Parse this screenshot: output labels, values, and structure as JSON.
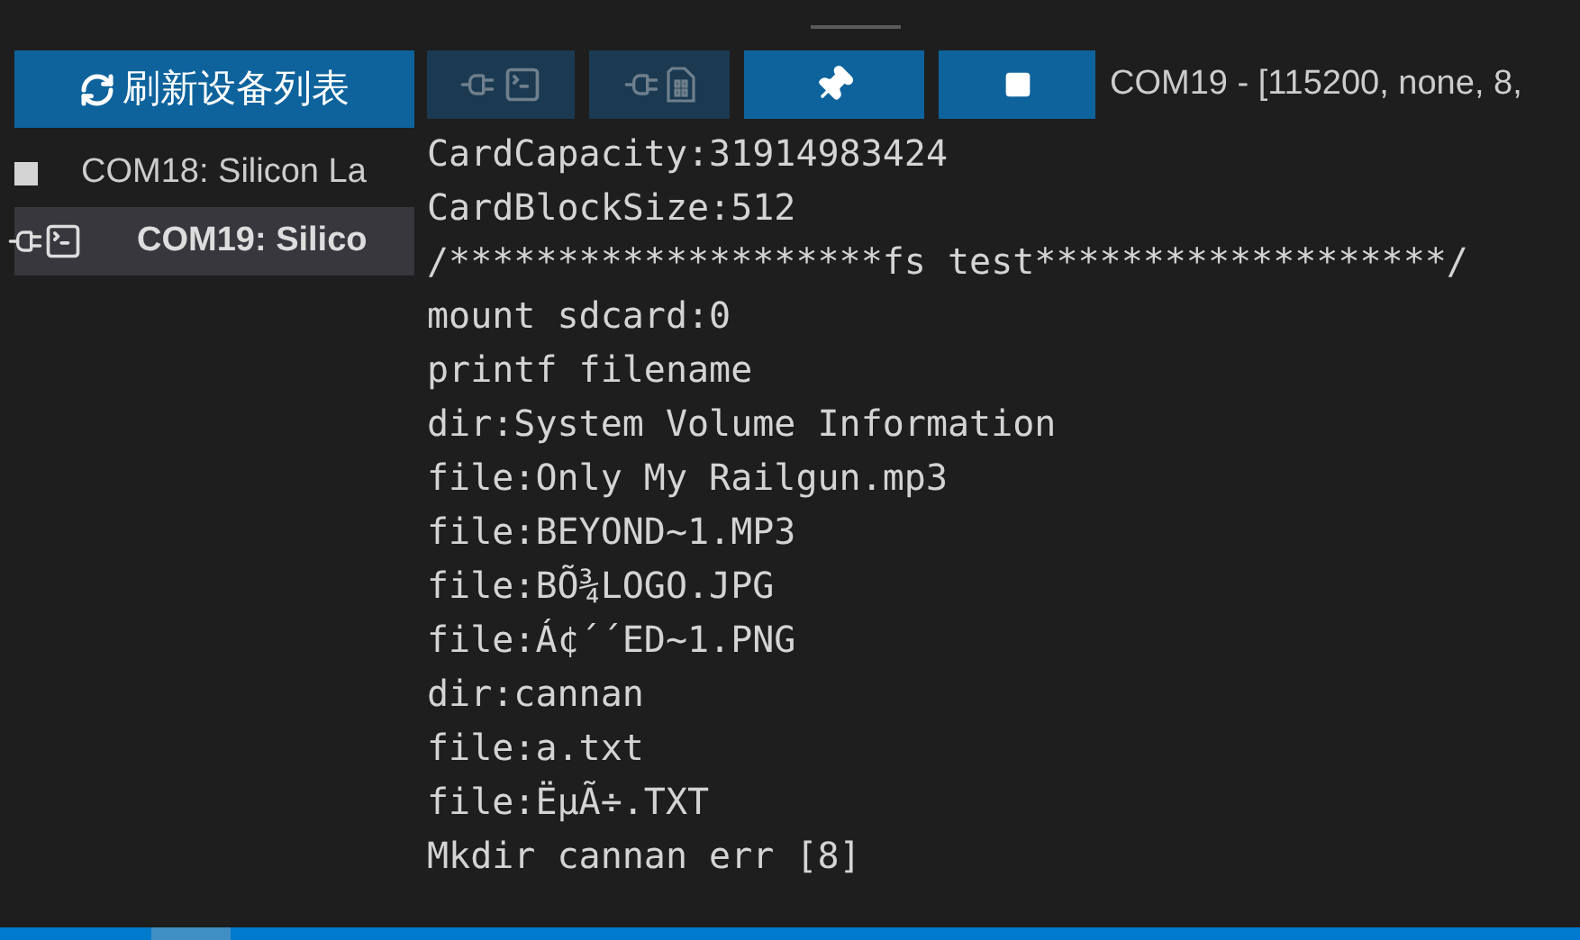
{
  "refresh_button": {
    "label": "刷新设备列表"
  },
  "toolbar": [
    {
      "kind": "plug-terminal",
      "disabled": true
    },
    {
      "kind": "plug-sdcard",
      "disabled": true
    },
    {
      "kind": "pin",
      "disabled": false
    },
    {
      "kind": "stop",
      "disabled": false
    }
  ],
  "connection_status": "COM19 - [115200, none, 8,",
  "ports": [
    {
      "label": "COM18: Silicon La",
      "selected": false,
      "connected": false
    },
    {
      "label": "COM19: Silico",
      "selected": true,
      "connected": true
    }
  ],
  "output_lines": [
    "CardCapacity:31914983424",
    "CardBlockSize:512",
    "/********************fs test*******************/",
    "mount sdcard:0",
    "printf filename",
    "dir:System Volume Information",
    "file:Only My Railgun.mp3",
    "file:BEYOND~1.MP3",
    "file:BÕ¾LOGO.JPG",
    "file:Á¢´´ED~1.PNG",
    "dir:cannan",
    "file:a.txt",
    "file:ËµÃ÷.TXT",
    "Mkdir cannan err [8]"
  ]
}
